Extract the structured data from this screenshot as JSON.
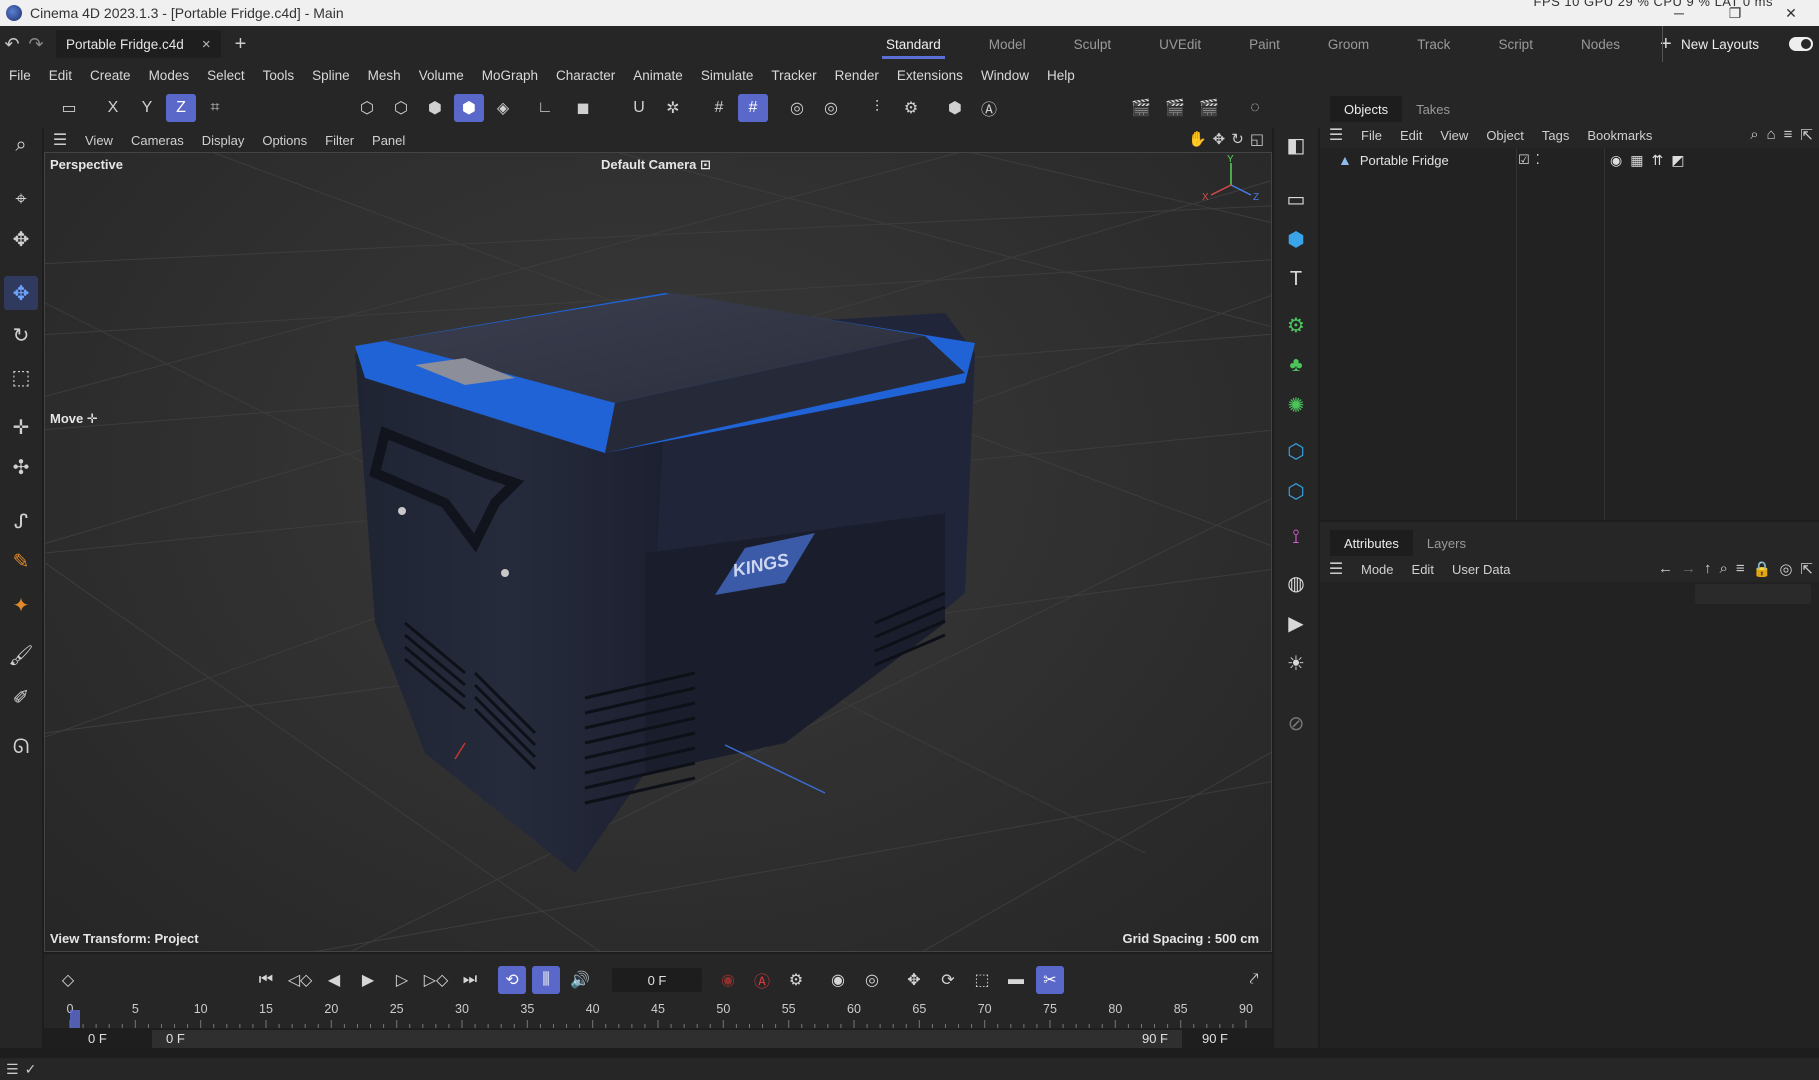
{
  "window": {
    "title": "Cinema 4D 2023.1.3 - [Portable Fridge.c4d] - Main",
    "perf": "FPS 10   GPU 29 %   CPU 9 %   LAT 0 ms",
    "minimize": "─",
    "restore": "❐",
    "close": "✕"
  },
  "tabbar": {
    "doc_tab": "Portable Fridge.c4d",
    "close_glyph": "×",
    "add_glyph": "+",
    "layouts": [
      "Standard",
      "Model",
      "Sculpt",
      "UVEdit",
      "Paint",
      "Groom",
      "Track",
      "Script",
      "Nodes"
    ],
    "active_layout": "Standard",
    "add_layout": "+",
    "new_layouts": "New Layouts"
  },
  "menubar": [
    "File",
    "Edit",
    "Create",
    "Modes",
    "Select",
    "Tools",
    "Spline",
    "Mesh",
    "Volume",
    "MoGraph",
    "Character",
    "Animate",
    "Simulate",
    "Tracker",
    "Render",
    "Extensions",
    "Window",
    "Help"
  ],
  "toolbar": {
    "axis_x": "X",
    "axis_y": "Y",
    "axis_z": "Z"
  },
  "viewport": {
    "menu": [
      "View",
      "Cameras",
      "Display",
      "Options",
      "Filter",
      "Panel"
    ],
    "projection": "Perspective",
    "camera": "Default Camera",
    "tool_label": "Move",
    "view_transform": "View Transform: Project",
    "grid_spacing": "Grid Spacing : 500 cm",
    "brand_text": "KINGS",
    "axis_x": "X",
    "axis_y": "Y",
    "axis_z": "Z"
  },
  "objects_panel": {
    "tabs": [
      "Objects",
      "Takes"
    ],
    "active_tab": "Objects",
    "menu": [
      "File",
      "Edit",
      "View",
      "Object",
      "Tags",
      "Bookmarks"
    ],
    "items": [
      {
        "name": "Portable Fridge"
      }
    ]
  },
  "attributes_panel": {
    "tabs": [
      "Attributes",
      "Layers"
    ],
    "active_tab": "Attributes",
    "menu": [
      "Mode",
      "Edit",
      "User Data"
    ]
  },
  "timeline": {
    "current_frame": "0 F",
    "ticks": [
      "0",
      "5",
      "10",
      "15",
      "20",
      "25",
      "30",
      "35",
      "40",
      "45",
      "50",
      "55",
      "60",
      "65",
      "70",
      "75",
      "80",
      "85",
      "90"
    ],
    "start_field": "0 F",
    "range_start": "0 F",
    "range_end": "90 F",
    "end_field": "90 F"
  },
  "colors": {
    "accent": "#5a68c9",
    "fridge_blue": "#1f63d6",
    "fridge_body": "#23283a"
  }
}
